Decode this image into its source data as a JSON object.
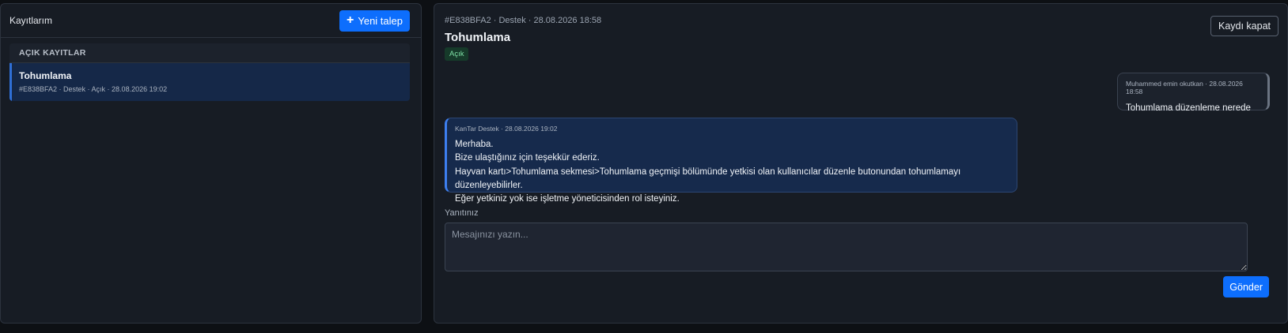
{
  "left": {
    "title": "Kayıtlarım",
    "new_button_label": "Yeni talep",
    "new_button_icon": "plus-icon",
    "section_header": "AÇIK KAYITLAR",
    "items": [
      {
        "title": "Tohumlama",
        "meta": "#E838BFA2 · Destek · Açık · 28.08.2026 19:02"
      }
    ]
  },
  "ticket": {
    "meta": "#E838BFA2 · Destek · 28.08.2026 18:58",
    "title": "Tohumlama",
    "status": "Açık",
    "close_button_label": "Kaydı kapat"
  },
  "messages": [
    {
      "author_line": "Muhammed emin okutkan · 28.08.2026 18:58",
      "lines": [
        "Tohumlama düzenleme nerede"
      ]
    },
    {
      "author_line": "KanTar Destek · 28.08.2026 19:02",
      "lines": [
        "Merhaba.",
        "Bize ulaştığınız için teşekkür ederiz.",
        "Hayvan kartı>Tohumlama sekmesi>Tohumlama geçmişi bölümünde yetkisi olan kullanıcılar düzenle butonundan tohumlamayı düzenleyebilirler.",
        "Eğer yetkiniz yok ise işletme yöneticisinden rol isteyiniz."
      ]
    }
  ],
  "reply": {
    "label": "Yanıtınız",
    "placeholder": "Mesajınızı yazın...",
    "value": "",
    "send_label": "Gönder"
  },
  "colors": {
    "accent": "#0d6efd",
    "panel_bg": "#171c24",
    "page_bg": "#0d1014",
    "status_bg": "#163a2a",
    "status_text": "#7fe0a6"
  }
}
